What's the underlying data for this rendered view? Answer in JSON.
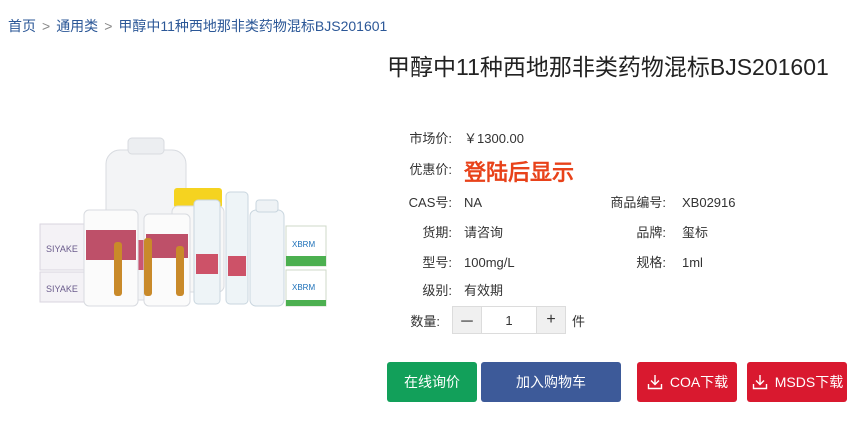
{
  "breadcrumb": {
    "items": [
      "首页",
      "通用类",
      "甲醇中11种西地那非类药物混标BJS201601"
    ],
    "separator": ">"
  },
  "product": {
    "title": "甲醇中11种西地那非类药物混标BJS201601",
    "image_brand_labels": [
      "SIYAKE",
      "SIYAKE",
      "XBRM",
      "XBRM"
    ]
  },
  "info": {
    "market_price": {
      "label": "市场价:",
      "value": "￥1300.00"
    },
    "promo_price": {
      "label": "优惠价:",
      "value": "登陆后显示"
    },
    "cas": {
      "label": "CAS号:",
      "value": "NA"
    },
    "product_code": {
      "label": "商品编号:",
      "value": "XB02916"
    },
    "delivery": {
      "label": "货期:",
      "value": "请咨询"
    },
    "brand": {
      "label": "品牌:",
      "value": "玺标"
    },
    "model": {
      "label": "型号:",
      "value": "100mg/L"
    },
    "spec": {
      "label": "规格:",
      "value": "1ml"
    },
    "grade": {
      "label": "级别:",
      "value": "有效期"
    }
  },
  "quantity": {
    "label": "数量:",
    "minus": "－",
    "value": "1",
    "plus": "+",
    "unit": "件"
  },
  "actions": {
    "inquiry": "在线询价",
    "add_to_cart": "加入购物车",
    "coa_download": "COA下载",
    "msds_download": "MSDS下载"
  },
  "colors": {
    "breadcrumb": "#2b5797",
    "promo": "#e8421a",
    "inquiry_btn": "#12a05a",
    "cart_btn": "#3d5a99",
    "download_btn": "#d9192f"
  }
}
